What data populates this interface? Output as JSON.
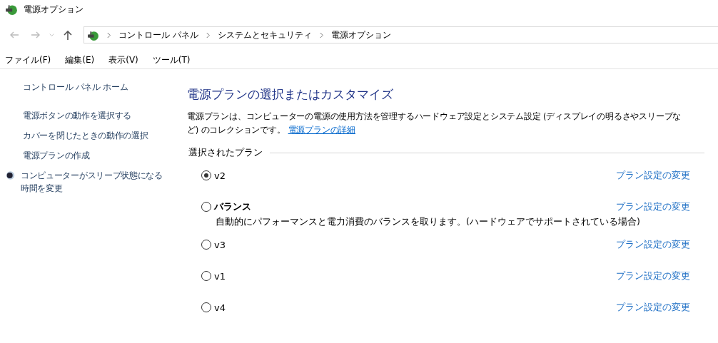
{
  "window": {
    "title": "電源オプション"
  },
  "breadcrumb": [
    "コントロール パネル",
    "システムとセキュリティ",
    "電源オプション"
  ],
  "menu": [
    "ファイル(F)",
    "編集(E)",
    "表示(V)",
    "ツール(T)"
  ],
  "sidebar": {
    "home": "コントロール パネル ホーム",
    "items": [
      {
        "label": "電源ボタンの動作を選択する",
        "kind": "link"
      },
      {
        "label": "カバーを閉じたときの動作の選択",
        "kind": "link"
      },
      {
        "label": "電源プランの作成",
        "kind": "link"
      },
      {
        "label": "コンピューターがスリープ状態になる時間を変更",
        "kind": "icon-link"
      }
    ]
  },
  "main": {
    "heading": "電源プランの選択またはカスタマイズ",
    "description": "電源プランは、コンピューターの電源の使用方法を管理するハードウェア設定とシステム設定 (ディスプレイの明るさやスリープなど) のコレクションです。",
    "details_link": "電源プランの詳細",
    "group_label": "選択されたプラン",
    "plans": [
      {
        "name": "v2",
        "selected": true,
        "bold": false,
        "link": "プラン設定の変更"
      },
      {
        "name": "バランス",
        "selected": false,
        "bold": true,
        "description": "自動的にパフォーマンスと電力消費のバランスを取ります。(ハードウェアでサポートされている場合)",
        "link": "プラン設定の変更"
      },
      {
        "name": "v3",
        "selected": false,
        "bold": false,
        "link": "プラン設定の変更"
      },
      {
        "name": "v1",
        "selected": false,
        "bold": false,
        "link": "プラン設定の変更"
      },
      {
        "name": "v4",
        "selected": false,
        "bold": false,
        "link": "プラン設定の変更"
      }
    ]
  }
}
